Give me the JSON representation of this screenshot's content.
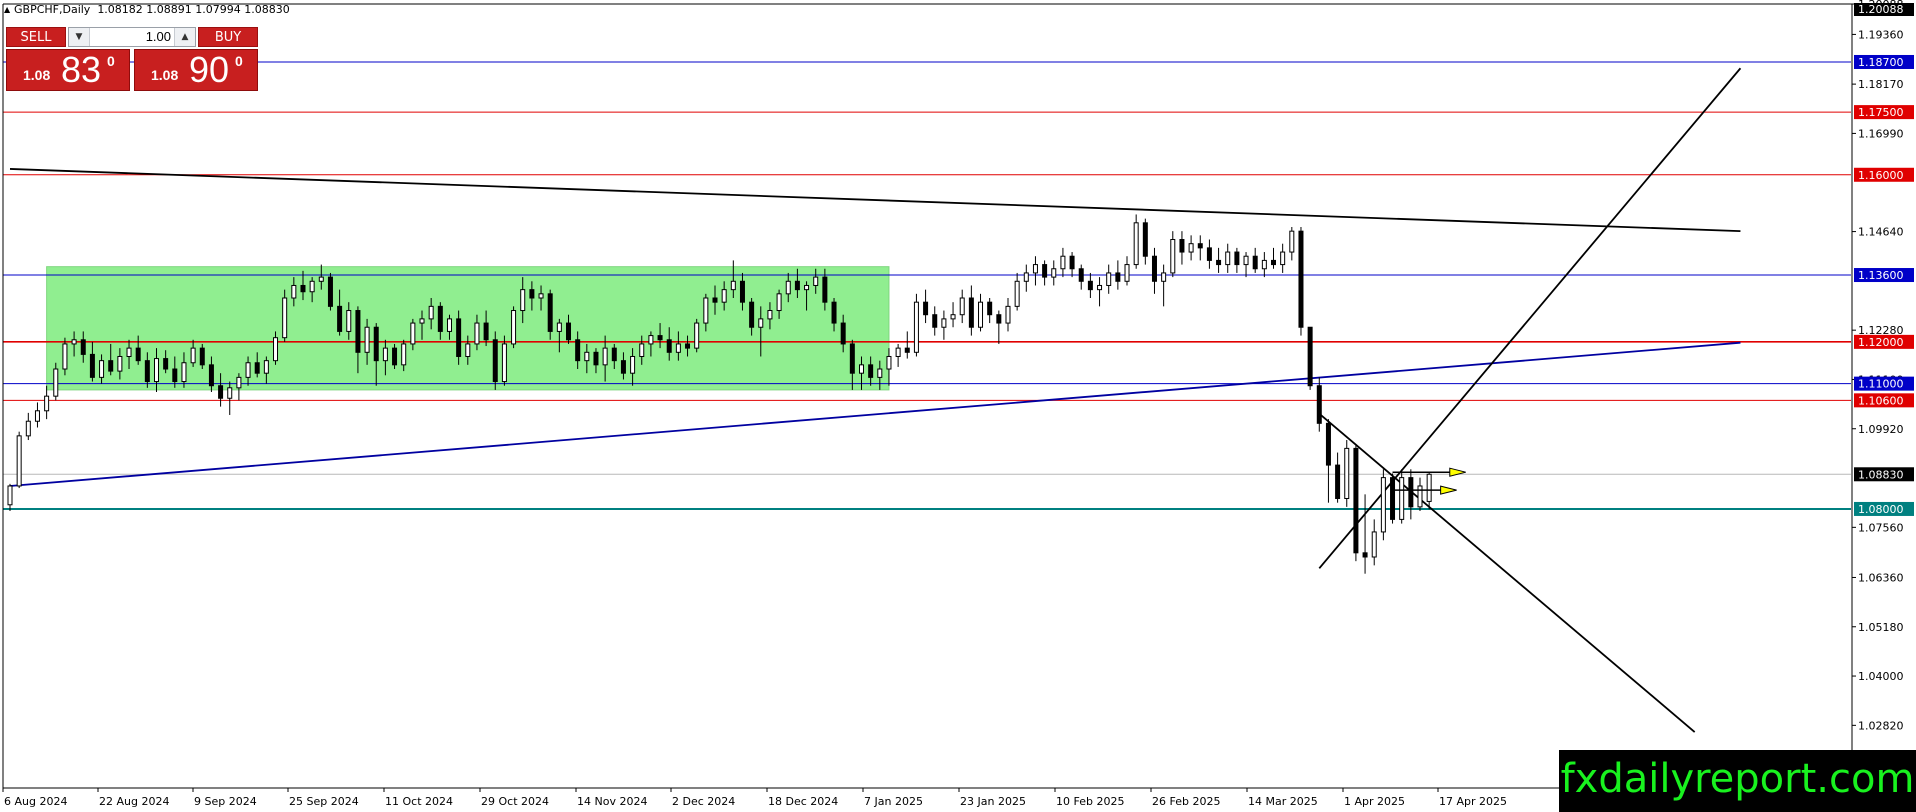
{
  "header": {
    "symbol": "GBPCHF,Daily",
    "ohlc": "1.08182 1.08891 1.07994 1.08830"
  },
  "trade_panel": {
    "sell_label": "SELL",
    "buy_label": "BUY",
    "lot_value": "1.00",
    "sell_price_small": "1.08",
    "sell_price_big": "83",
    "sell_price_sup": "0",
    "buy_price_small": "1.08",
    "buy_price_big": "90",
    "buy_price_sup": "0"
  },
  "watermark": "fxdailyreport.com",
  "colors": {
    "bull_candle": "#ffffff",
    "bear_candle": "#000000",
    "range_box": "#90ee90",
    "sell_button": "#c81f1f",
    "watermark_text": "#19f21f"
  },
  "chart_data": {
    "type": "candlestick",
    "title": "GBPCHF,Daily",
    "ylim": [
      1.0132,
      1.20088
    ],
    "y_ticks": [
      "1.20088",
      "1.19360",
      "1.18170",
      "1.16990",
      "1.14640",
      "1.12280",
      "1.11100",
      "1.09920",
      "1.07560",
      "1.06360",
      "1.05180",
      "1.04000",
      "1.02820"
    ],
    "x_ticks": [
      "6 Aug 2024",
      "22 Aug 2024",
      "9 Sep 2024",
      "25 Sep 2024",
      "11 Oct 2024",
      "29 Oct 2024",
      "14 Nov 2024",
      "2 Dec 2024",
      "18 Dec 2024",
      "7 Jan 2025",
      "23 Jan 2025",
      "10 Feb 2025",
      "26 Feb 2025",
      "14 Mar 2025",
      "1 Apr 2025",
      "17 Apr 2025"
    ],
    "horizontal_levels": [
      {
        "value": 1.187,
        "label": "1.18700",
        "color": "#0000c8"
      },
      {
        "value": 1.175,
        "label": "1.17500",
        "color": "#e00000"
      },
      {
        "value": 1.16,
        "label": "1.16000",
        "color": "#e00000"
      },
      {
        "value": 1.136,
        "label": "1.13600",
        "color": "#0000c8"
      },
      {
        "value": 1.12,
        "label": "1.12000",
        "color": "#e00000"
      },
      {
        "value": 1.11,
        "label": "1.11000",
        "color": "#0000c8"
      },
      {
        "value": 1.106,
        "label": "1.10600",
        "color": "#e00000"
      },
      {
        "value": 1.0883,
        "label": "1.08830",
        "color": "#000000"
      },
      {
        "value": 1.08,
        "label": "1.08000",
        "color": "#008080"
      }
    ],
    "current_price": 1.0883,
    "trendlines": [
      {
        "from": [
          0,
          1.1614
        ],
        "to": [
          189,
          1.1465
        ],
        "color": "#000000"
      },
      {
        "from": [
          0,
          1.0855
        ],
        "to": [
          189,
          1.1198
        ],
        "color": "#0000a0"
      },
      {
        "from": [
          143,
          1.1028
        ],
        "to": [
          184,
          1.0266
        ],
        "color": "#000000"
      },
      {
        "from": [
          143,
          1.0658
        ],
        "to": [
          189,
          1.1855
        ],
        "color": "#000000"
      }
    ],
    "range_box": {
      "x_from": 4,
      "x_to": 96,
      "y_from": 1.1085,
      "y_to": 1.138
    },
    "projection_arrows": [
      {
        "from": [
          151,
          1.0888
        ],
        "to": [
          159,
          1.0888
        ]
      },
      {
        "from": [
          151,
          1.0845
        ],
        "to": [
          158,
          1.0845
        ]
      }
    ],
    "candles": [
      {
        "o": 1.081,
        "h": 1.086,
        "l": 1.0795,
        "c": 1.0855
      },
      {
        "o": 1.0855,
        "h": 1.0985,
        "l": 1.085,
        "c": 1.0975
      },
      {
        "o": 1.0975,
        "h": 1.103,
        "l": 1.0965,
        "c": 1.101
      },
      {
        "o": 1.101,
        "h": 1.1055,
        "l": 1.0995,
        "c": 1.1035
      },
      {
        "o": 1.1035,
        "h": 1.1095,
        "l": 1.1015,
        "c": 1.107
      },
      {
        "o": 1.107,
        "h": 1.115,
        "l": 1.106,
        "c": 1.1135
      },
      {
        "o": 1.1135,
        "h": 1.121,
        "l": 1.112,
        "c": 1.1195
      },
      {
        "o": 1.1195,
        "h": 1.1225,
        "l": 1.1165,
        "c": 1.1205
      },
      {
        "o": 1.1205,
        "h": 1.1225,
        "l": 1.115,
        "c": 1.117
      },
      {
        "o": 1.117,
        "h": 1.12,
        "l": 1.1105,
        "c": 1.1115
      },
      {
        "o": 1.1115,
        "h": 1.117,
        "l": 1.11,
        "c": 1.1155
      },
      {
        "o": 1.1155,
        "h": 1.1195,
        "l": 1.112,
        "c": 1.113
      },
      {
        "o": 1.113,
        "h": 1.1185,
        "l": 1.111,
        "c": 1.1165
      },
      {
        "o": 1.1165,
        "h": 1.1205,
        "l": 1.1135,
        "c": 1.1185
      },
      {
        "o": 1.1185,
        "h": 1.1215,
        "l": 1.1145,
        "c": 1.1155
      },
      {
        "o": 1.1155,
        "h": 1.1175,
        "l": 1.109,
        "c": 1.1105
      },
      {
        "o": 1.1105,
        "h": 1.1185,
        "l": 1.108,
        "c": 1.116
      },
      {
        "o": 1.116,
        "h": 1.118,
        "l": 1.1125,
        "c": 1.1135
      },
      {
        "o": 1.1135,
        "h": 1.1165,
        "l": 1.109,
        "c": 1.1105
      },
      {
        "o": 1.1105,
        "h": 1.1175,
        "l": 1.109,
        "c": 1.115
      },
      {
        "o": 1.115,
        "h": 1.1205,
        "l": 1.114,
        "c": 1.1185
      },
      {
        "o": 1.1185,
        "h": 1.1195,
        "l": 1.1135,
        "c": 1.1145
      },
      {
        "o": 1.1145,
        "h": 1.1165,
        "l": 1.108,
        "c": 1.1095
      },
      {
        "o": 1.1095,
        "h": 1.1125,
        "l": 1.1045,
        "c": 1.1065
      },
      {
        "o": 1.1065,
        "h": 1.1105,
        "l": 1.1025,
        "c": 1.109
      },
      {
        "o": 1.109,
        "h": 1.1125,
        "l": 1.106,
        "c": 1.1115
      },
      {
        "o": 1.1115,
        "h": 1.1165,
        "l": 1.1095,
        "c": 1.115
      },
      {
        "o": 1.115,
        "h": 1.1175,
        "l": 1.1115,
        "c": 1.1125
      },
      {
        "o": 1.1125,
        "h": 1.1165,
        "l": 1.11,
        "c": 1.1155
      },
      {
        "o": 1.1155,
        "h": 1.1225,
        "l": 1.1145,
        "c": 1.121
      },
      {
        "o": 1.121,
        "h": 1.1325,
        "l": 1.12,
        "c": 1.1305
      },
      {
        "o": 1.1305,
        "h": 1.1355,
        "l": 1.1285,
        "c": 1.1335
      },
      {
        "o": 1.1335,
        "h": 1.137,
        "l": 1.13,
        "c": 1.132
      },
      {
        "o": 1.132,
        "h": 1.1355,
        "l": 1.1295,
        "c": 1.1345
      },
      {
        "o": 1.1345,
        "h": 1.1385,
        "l": 1.1325,
        "c": 1.1355
      },
      {
        "o": 1.1355,
        "h": 1.1365,
        "l": 1.1275,
        "c": 1.1285
      },
      {
        "o": 1.1285,
        "h": 1.1325,
        "l": 1.1215,
        "c": 1.1225
      },
      {
        "o": 1.1225,
        "h": 1.1295,
        "l": 1.1205,
        "c": 1.1275
      },
      {
        "o": 1.1275,
        "h": 1.1285,
        "l": 1.1125,
        "c": 1.1175
      },
      {
        "o": 1.1175,
        "h": 1.1255,
        "l": 1.1145,
        "c": 1.1235
      },
      {
        "o": 1.1235,
        "h": 1.1245,
        "l": 1.1095,
        "c": 1.1155
      },
      {
        "o": 1.1155,
        "h": 1.1205,
        "l": 1.112,
        "c": 1.1185
      },
      {
        "o": 1.1185,
        "h": 1.1195,
        "l": 1.1135,
        "c": 1.1145
      },
      {
        "o": 1.1145,
        "h": 1.1205,
        "l": 1.113,
        "c": 1.1195
      },
      {
        "o": 1.1195,
        "h": 1.1255,
        "l": 1.118,
        "c": 1.1245
      },
      {
        "o": 1.1245,
        "h": 1.1275,
        "l": 1.1205,
        "c": 1.1255
      },
      {
        "o": 1.1255,
        "h": 1.1305,
        "l": 1.123,
        "c": 1.1285
      },
      {
        "o": 1.1285,
        "h": 1.1295,
        "l": 1.1205,
        "c": 1.1225
      },
      {
        "o": 1.1225,
        "h": 1.1265,
        "l": 1.1205,
        "c": 1.1255
      },
      {
        "o": 1.1255,
        "h": 1.1275,
        "l": 1.1145,
        "c": 1.1165
      },
      {
        "o": 1.1165,
        "h": 1.1215,
        "l": 1.1145,
        "c": 1.1195
      },
      {
        "o": 1.1195,
        "h": 1.1265,
        "l": 1.118,
        "c": 1.1245
      },
      {
        "o": 1.1245,
        "h": 1.1275,
        "l": 1.119,
        "c": 1.1205
      },
      {
        "o": 1.1205,
        "h": 1.1225,
        "l": 1.1085,
        "c": 1.1105
      },
      {
        "o": 1.1105,
        "h": 1.1215,
        "l": 1.1095,
        "c": 1.1195
      },
      {
        "o": 1.1195,
        "h": 1.1285,
        "l": 1.1185,
        "c": 1.1275
      },
      {
        "o": 1.1275,
        "h": 1.1355,
        "l": 1.1245,
        "c": 1.1325
      },
      {
        "o": 1.1325,
        "h": 1.1345,
        "l": 1.1275,
        "c": 1.1305
      },
      {
        "o": 1.1305,
        "h": 1.1335,
        "l": 1.1275,
        "c": 1.1315
      },
      {
        "o": 1.1315,
        "h": 1.1325,
        "l": 1.1205,
        "c": 1.1225
      },
      {
        "o": 1.1225,
        "h": 1.1255,
        "l": 1.1175,
        "c": 1.1245
      },
      {
        "o": 1.1245,
        "h": 1.1265,
        "l": 1.1195,
        "c": 1.1205
      },
      {
        "o": 1.1205,
        "h": 1.1225,
        "l": 1.1135,
        "c": 1.1155
      },
      {
        "o": 1.1155,
        "h": 1.1195,
        "l": 1.1125,
        "c": 1.1175
      },
      {
        "o": 1.1175,
        "h": 1.1185,
        "l": 1.1125,
        "c": 1.1145
      },
      {
        "o": 1.1145,
        "h": 1.1215,
        "l": 1.1105,
        "c": 1.1185
      },
      {
        "o": 1.1185,
        "h": 1.1195,
        "l": 1.1135,
        "c": 1.1155
      },
      {
        "o": 1.1155,
        "h": 1.1175,
        "l": 1.111,
        "c": 1.1125
      },
      {
        "o": 1.1125,
        "h": 1.1185,
        "l": 1.1095,
        "c": 1.1165
      },
      {
        "o": 1.1165,
        "h": 1.1215,
        "l": 1.1145,
        "c": 1.1195
      },
      {
        "o": 1.1195,
        "h": 1.1225,
        "l": 1.1165,
        "c": 1.1215
      },
      {
        "o": 1.1215,
        "h": 1.1245,
        "l": 1.1185,
        "c": 1.1205
      },
      {
        "o": 1.1205,
        "h": 1.1235,
        "l": 1.1155,
        "c": 1.1175
      },
      {
        "o": 1.1175,
        "h": 1.1225,
        "l": 1.1155,
        "c": 1.1195
      },
      {
        "o": 1.1195,
        "h": 1.1215,
        "l": 1.1165,
        "c": 1.1185
      },
      {
        "o": 1.1185,
        "h": 1.1255,
        "l": 1.1175,
        "c": 1.1245
      },
      {
        "o": 1.1245,
        "h": 1.1315,
        "l": 1.1225,
        "c": 1.1305
      },
      {
        "o": 1.1305,
        "h": 1.1335,
        "l": 1.1265,
        "c": 1.1295
      },
      {
        "o": 1.1295,
        "h": 1.1345,
        "l": 1.1275,
        "c": 1.1325
      },
      {
        "o": 1.1325,
        "h": 1.1395,
        "l": 1.1305,
        "c": 1.1345
      },
      {
        "o": 1.1345,
        "h": 1.1365,
        "l": 1.1275,
        "c": 1.1295
      },
      {
        "o": 1.1295,
        "h": 1.1305,
        "l": 1.1215,
        "c": 1.1235
      },
      {
        "o": 1.1235,
        "h": 1.1285,
        "l": 1.1165,
        "c": 1.1255
      },
      {
        "o": 1.1255,
        "h": 1.1295,
        "l": 1.123,
        "c": 1.1275
      },
      {
        "o": 1.1275,
        "h": 1.1325,
        "l": 1.1255,
        "c": 1.1315
      },
      {
        "o": 1.1315,
        "h": 1.1365,
        "l": 1.1295,
        "c": 1.1345
      },
      {
        "o": 1.1345,
        "h": 1.1375,
        "l": 1.1305,
        "c": 1.1325
      },
      {
        "o": 1.1325,
        "h": 1.1345,
        "l": 1.1275,
        "c": 1.1335
      },
      {
        "o": 1.1335,
        "h": 1.1375,
        "l": 1.1315,
        "c": 1.1355
      },
      {
        "o": 1.1355,
        "h": 1.1375,
        "l": 1.1275,
        "c": 1.1295
      },
      {
        "o": 1.1295,
        "h": 1.1305,
        "l": 1.1225,
        "c": 1.1245
      },
      {
        "o": 1.1245,
        "h": 1.1265,
        "l": 1.1175,
        "c": 1.1195
      },
      {
        "o": 1.1195,
        "h": 1.1205,
        "l": 1.1085,
        "c": 1.1125
      },
      {
        "o": 1.1125,
        "h": 1.1165,
        "l": 1.1085,
        "c": 1.1145
      },
      {
        "o": 1.1145,
        "h": 1.1165,
        "l": 1.1095,
        "c": 1.1115
      },
      {
        "o": 1.1115,
        "h": 1.1155,
        "l": 1.1085,
        "c": 1.1135
      },
      {
        "o": 1.1135,
        "h": 1.1185,
        "l": 1.1095,
        "c": 1.1165
      },
      {
        "o": 1.1165,
        "h": 1.1195,
        "l": 1.114,
        "c": 1.1185
      },
      {
        "o": 1.1185,
        "h": 1.1225,
        "l": 1.116,
        "c": 1.1175
      },
      {
        "o": 1.1175,
        "h": 1.1315,
        "l": 1.1165,
        "c": 1.1295
      },
      {
        "o": 1.1295,
        "h": 1.1325,
        "l": 1.1245,
        "c": 1.1265
      },
      {
        "o": 1.1265,
        "h": 1.1285,
        "l": 1.1215,
        "c": 1.1235
      },
      {
        "o": 1.1235,
        "h": 1.1275,
        "l": 1.1205,
        "c": 1.1255
      },
      {
        "o": 1.1255,
        "h": 1.1295,
        "l": 1.1235,
        "c": 1.1265
      },
      {
        "o": 1.1265,
        "h": 1.1325,
        "l": 1.1245,
        "c": 1.1305
      },
      {
        "o": 1.1305,
        "h": 1.1335,
        "l": 1.1215,
        "c": 1.1235
      },
      {
        "o": 1.1235,
        "h": 1.1315,
        "l": 1.1225,
        "c": 1.1295
      },
      {
        "o": 1.1295,
        "h": 1.1305,
        "l": 1.1245,
        "c": 1.1265
      },
      {
        "o": 1.1265,
        "h": 1.1275,
        "l": 1.1195,
        "c": 1.1245
      },
      {
        "o": 1.1245,
        "h": 1.1305,
        "l": 1.1225,
        "c": 1.1285
      },
      {
        "o": 1.1285,
        "h": 1.1365,
        "l": 1.1275,
        "c": 1.1345
      },
      {
        "o": 1.1345,
        "h": 1.1385,
        "l": 1.132,
        "c": 1.1365
      },
      {
        "o": 1.1365,
        "h": 1.1405,
        "l": 1.1335,
        "c": 1.1385
      },
      {
        "o": 1.1385,
        "h": 1.1395,
        "l": 1.1335,
        "c": 1.1355
      },
      {
        "o": 1.1355,
        "h": 1.1395,
        "l": 1.1335,
        "c": 1.1375
      },
      {
        "o": 1.1375,
        "h": 1.1425,
        "l": 1.1355,
        "c": 1.1405
      },
      {
        "o": 1.1405,
        "h": 1.1415,
        "l": 1.1355,
        "c": 1.1375
      },
      {
        "o": 1.1375,
        "h": 1.1385,
        "l": 1.1325,
        "c": 1.1345
      },
      {
        "o": 1.1345,
        "h": 1.1365,
        "l": 1.1305,
        "c": 1.1325
      },
      {
        "o": 1.1325,
        "h": 1.1355,
        "l": 1.1285,
        "c": 1.1335
      },
      {
        "o": 1.1335,
        "h": 1.1385,
        "l": 1.1315,
        "c": 1.1365
      },
      {
        "o": 1.1365,
        "h": 1.1395,
        "l": 1.1325,
        "c": 1.1345
      },
      {
        "o": 1.1345,
        "h": 1.1405,
        "l": 1.1335,
        "c": 1.1385
      },
      {
        "o": 1.1385,
        "h": 1.1505,
        "l": 1.1375,
        "c": 1.1485
      },
      {
        "o": 1.1485,
        "h": 1.1495,
        "l": 1.1385,
        "c": 1.1405
      },
      {
        "o": 1.1405,
        "h": 1.1425,
        "l": 1.1315,
        "c": 1.1345
      },
      {
        "o": 1.1345,
        "h": 1.1385,
        "l": 1.1285,
        "c": 1.1365
      },
      {
        "o": 1.1365,
        "h": 1.1465,
        "l": 1.1355,
        "c": 1.1445
      },
      {
        "o": 1.1445,
        "h": 1.1465,
        "l": 1.1385,
        "c": 1.1415
      },
      {
        "o": 1.1415,
        "h": 1.1455,
        "l": 1.1395,
        "c": 1.1435
      },
      {
        "o": 1.1435,
        "h": 1.1455,
        "l": 1.1395,
        "c": 1.1425
      },
      {
        "o": 1.1425,
        "h": 1.1445,
        "l": 1.1375,
        "c": 1.1395
      },
      {
        "o": 1.1395,
        "h": 1.1425,
        "l": 1.1365,
        "c": 1.1385
      },
      {
        "o": 1.1385,
        "h": 1.1435,
        "l": 1.1365,
        "c": 1.1415
      },
      {
        "o": 1.1415,
        "h": 1.1425,
        "l": 1.1365,
        "c": 1.1385
      },
      {
        "o": 1.1385,
        "h": 1.1415,
        "l": 1.1355,
        "c": 1.1405
      },
      {
        "o": 1.1405,
        "h": 1.1425,
        "l": 1.1365,
        "c": 1.1375
      },
      {
        "o": 1.1375,
        "h": 1.1415,
        "l": 1.1355,
        "c": 1.1395
      },
      {
        "o": 1.1395,
        "h": 1.1425,
        "l": 1.1375,
        "c": 1.1385
      },
      {
        "o": 1.1385,
        "h": 1.1435,
        "l": 1.1365,
        "c": 1.1415
      },
      {
        "o": 1.1415,
        "h": 1.1475,
        "l": 1.1395,
        "c": 1.1465
      },
      {
        "o": 1.1465,
        "h": 1.1475,
        "l": 1.1215,
        "c": 1.1235
      },
      {
        "o": 1.1235,
        "h": 1.1235,
        "l": 1.1085,
        "c": 1.1095
      },
      {
        "o": 1.1095,
        "h": 1.1115,
        "l": 1.0985,
        "c": 1.1005
      },
      {
        "o": 1.1005,
        "h": 1.1015,
        "l": 1.0815,
        "c": 1.0905
      },
      {
        "o": 1.0905,
        "h": 1.0935,
        "l": 1.0815,
        "c": 1.0825
      },
      {
        "o": 1.0825,
        "h": 1.0965,
        "l": 1.0805,
        "c": 1.0945
      },
      {
        "o": 1.0945,
        "h": 1.0955,
        "l": 1.0675,
        "c": 1.0695
      },
      {
        "o": 1.0695,
        "h": 1.0835,
        "l": 1.0645,
        "c": 1.0685
      },
      {
        "o": 1.0685,
        "h": 1.0775,
        "l": 1.0665,
        "c": 1.0745
      },
      {
        "o": 1.0745,
        "h": 1.0895,
        "l": 1.0725,
        "c": 1.0875
      },
      {
        "o": 1.0875,
        "h": 1.0885,
        "l": 1.0765,
        "c": 1.0775
      },
      {
        "o": 1.0775,
        "h": 1.0895,
        "l": 1.0765,
        "c": 1.0875
      },
      {
        "o": 1.0875,
        "h": 1.0895,
        "l": 1.0775,
        "c": 1.0805
      },
      {
        "o": 1.0805,
        "h": 1.0875,
        "l": 1.0795,
        "c": 1.0855
      },
      {
        "o": 1.0818,
        "h": 1.0889,
        "l": 1.0799,
        "c": 1.0883
      }
    ]
  }
}
